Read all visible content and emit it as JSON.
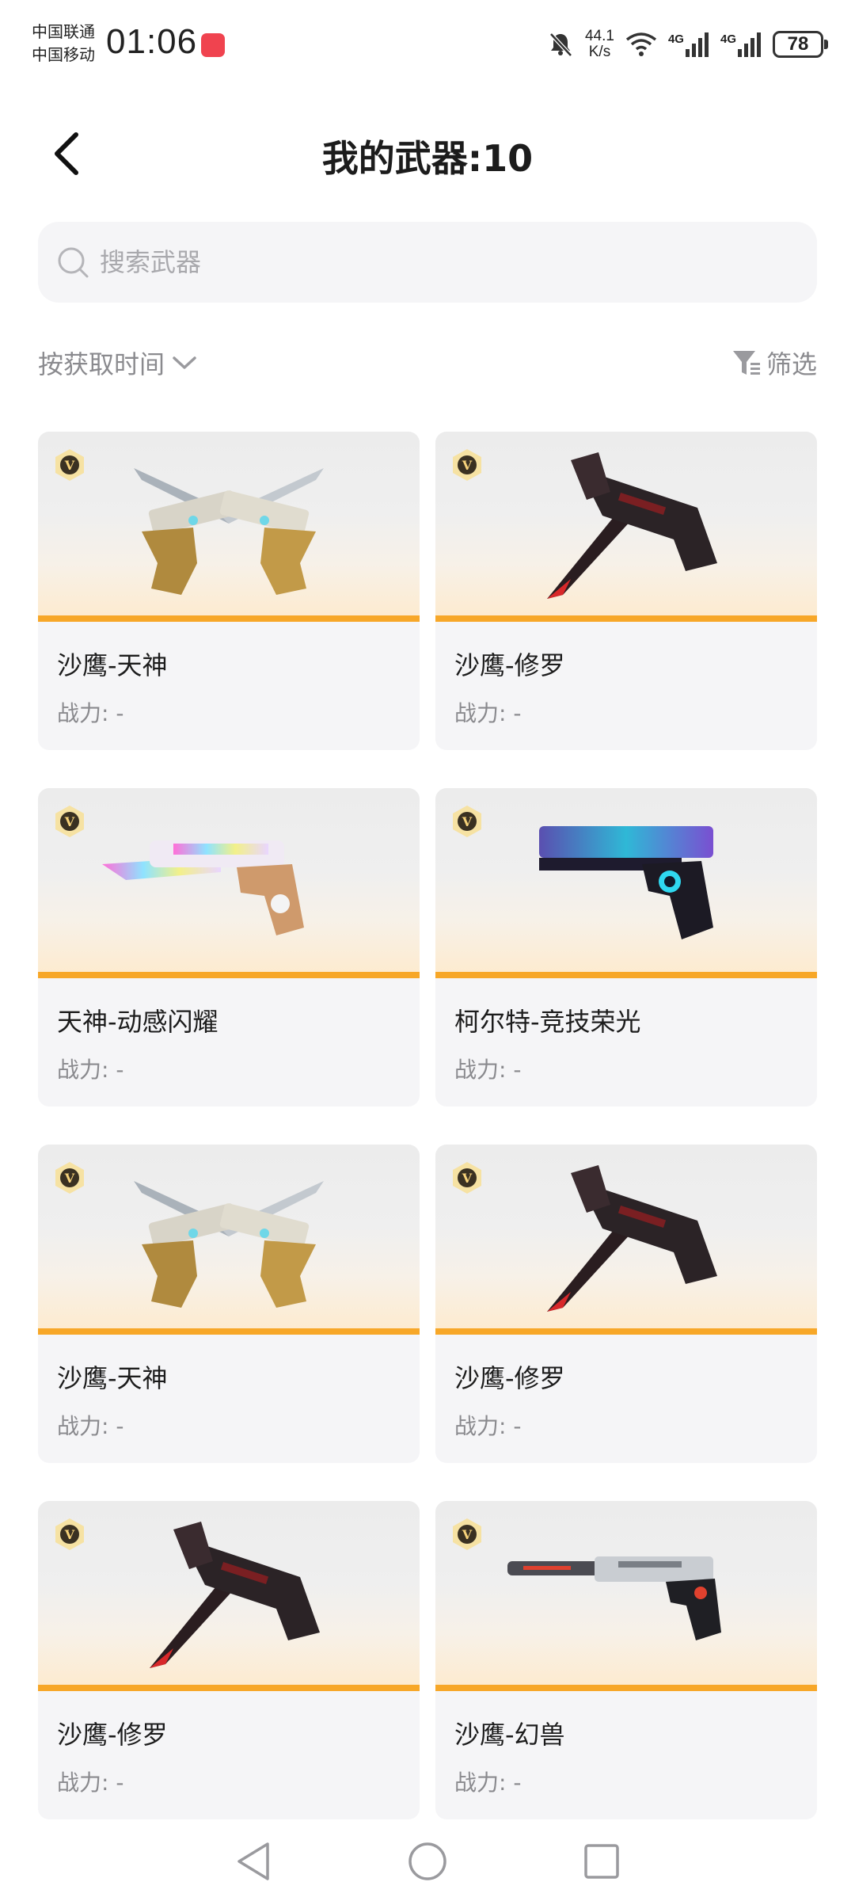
{
  "status_bar": {
    "carrier_1": "中国联通",
    "carrier_2": "中国移动",
    "time": "01:06",
    "net_speed_value": "44.1",
    "net_speed_unit": "K/s",
    "signal_1": "4G",
    "signal_2": "4G",
    "battery": "78"
  },
  "header": {
    "title": "我的武器:10"
  },
  "search": {
    "placeholder": "搜索武器"
  },
  "toolbar": {
    "sort_label": "按获取时间",
    "filter_label": "筛选"
  },
  "weapons": [
    {
      "name": "沙鹰-天神",
      "power": "战力: -",
      "icon": "gold-dual-pistol"
    },
    {
      "name": "沙鹰-修罗",
      "power": "战力: -",
      "icon": "dark-crossed-pistol"
    },
    {
      "name": "天神-动感闪耀",
      "power": "战力: -",
      "icon": "iridescent-pistol"
    },
    {
      "name": "柯尔特-竞技荣光",
      "power": "战力: -",
      "icon": "neon-colt-pistol"
    },
    {
      "name": "沙鹰-天神",
      "power": "战力: -",
      "icon": "gold-dual-pistol"
    },
    {
      "name": "沙鹰-修罗",
      "power": "战力: -",
      "icon": "dark-crossed-pistol"
    },
    {
      "name": "沙鹰-修罗",
      "power": "战力: -",
      "icon": "dark-crossed-pistol"
    },
    {
      "name": "沙鹰-幻兽",
      "power": "战力: -",
      "icon": "silver-long-pistol"
    }
  ],
  "badge_letter": "V",
  "colors": {
    "accent": "#f7a728",
    "card_bg": "#f5f5f7",
    "muted_text": "#8a8a8e",
    "app_badge": "#f0434f"
  }
}
